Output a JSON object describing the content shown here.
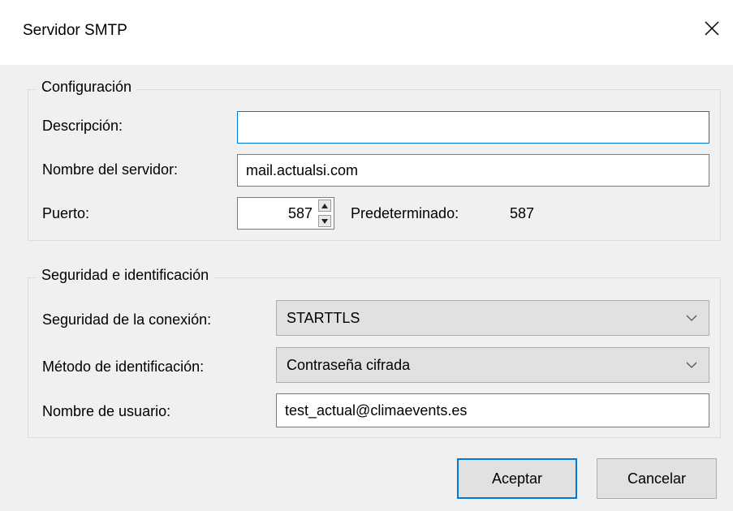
{
  "window": {
    "title": "Servidor SMTP",
    "close_icon": "close-icon"
  },
  "config": {
    "legend": "Configuración",
    "description_label": "Descripción:",
    "description_value": "",
    "server_label": "Nombre del servidor:",
    "server_value": "mail.actualsi.com",
    "port_label": "Puerto:",
    "port_value": "587",
    "default_label": "Predeterminado:",
    "default_value": "587"
  },
  "security": {
    "legend": "Seguridad e identificación",
    "connection_label": "Seguridad de la conexión:",
    "connection_value": "STARTTLS",
    "auth_label": "Método de identificación:",
    "auth_value": "Contraseña cifrada",
    "username_label": "Nombre de usuario:",
    "username_value": "test_actual@climaevents.es"
  },
  "buttons": {
    "ok": "Aceptar",
    "cancel": "Cancelar"
  },
  "colors": {
    "accent": "#0078d7",
    "window_bg": "#f0f0f0"
  }
}
